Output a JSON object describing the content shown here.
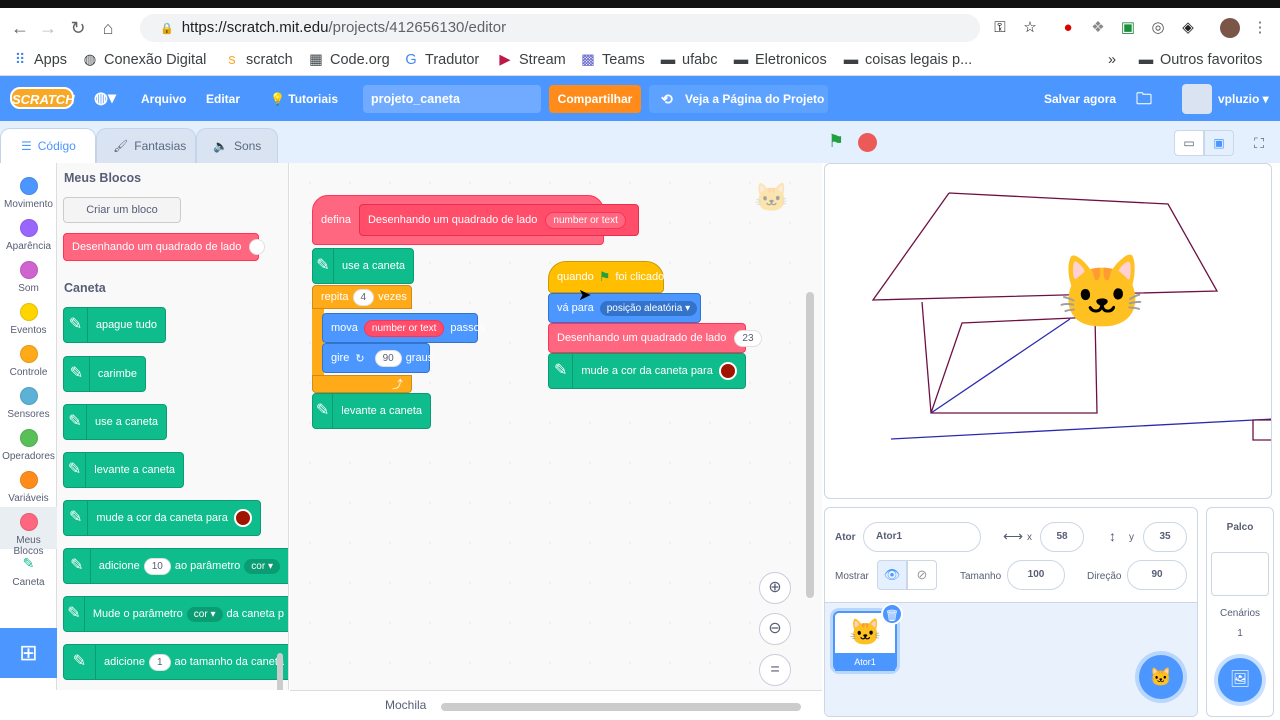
{
  "browser": {
    "url_host": "https://scratch.mit.edu",
    "url_path": "/projects/412656130/editor",
    "bookmarks": [
      "Apps",
      "Conexão Digital",
      "scratch",
      "Code.org",
      "Tradutor",
      "Stream",
      "Teams",
      "ufabc",
      "Eletronicos",
      "coisas legais p...",
      "Outros favoritos"
    ],
    "more": "»"
  },
  "menubar": {
    "logo": "SCRATCH",
    "file": "Arquivo",
    "edit": "Editar",
    "tutorials": "Tutoriais",
    "project_title": "projeto_caneta",
    "share": "Compartilhar",
    "project_page": "Veja a Página do Projeto",
    "save": "Salvar agora",
    "user": "vpluzio"
  },
  "tabs": {
    "code": "Código",
    "costumes": "Fantasias",
    "sounds": "Sons"
  },
  "categories": [
    {
      "label": "Movimento",
      "color": "#4c97ff"
    },
    {
      "label": "Aparência",
      "color": "#9966ff"
    },
    {
      "label": "Som",
      "color": "#cf63cf"
    },
    {
      "label": "Eventos",
      "color": "#ffd500"
    },
    {
      "label": "Controle",
      "color": "#ffab19"
    },
    {
      "label": "Sensores",
      "color": "#5cb1d6"
    },
    {
      "label": "Operadores",
      "color": "#59c059"
    },
    {
      "label": "Variáveis",
      "color": "#ff8c1a"
    },
    {
      "label": "Meus Blocos",
      "color": "#ff6680"
    },
    {
      "label": "Caneta",
      "color": "#0fbd8c"
    }
  ],
  "flyout": {
    "my_blocks_title": "Meus Blocos",
    "make_block": "Criar um bloco",
    "custom_block": "Desenhando um quadrado de lado",
    "pen_title": "Caneta",
    "pen_blocks": [
      "apague tudo",
      "carimbe",
      "use a caneta",
      "levante a caneta",
      "mude a cor da caneta para"
    ],
    "add_param": {
      "prefix": "adicione",
      "value": "10",
      "middle": "ao parâmetro",
      "param": "cor"
    },
    "change_param": {
      "prefix": "Mude o parâmetro",
      "param": "cor",
      "suffix": "da caneta p"
    },
    "add_size": {
      "prefix": "adicione",
      "value": "1",
      "suffix": "ao tamanho da caneta"
    }
  },
  "script1": {
    "define": "defina",
    "define_name": "Desenhando um quadrado de lado",
    "define_param": "number or text",
    "pen_down": "use a caneta",
    "repeat": "repita",
    "repeat_count": "4",
    "repeat_suffix": "vezes",
    "move": "mova",
    "move_param": "number or text",
    "move_suffix": "passos",
    "turn": "gire",
    "turn_value": "90",
    "turn_suffix": "graus",
    "pen_up": "levante a caneta"
  },
  "script2": {
    "when": "quando",
    "clicked": "foi clicado",
    "goto": "vá para",
    "goto_target": "posição aleatória",
    "call": "Desenhando um quadrado de lado",
    "call_value": "23",
    "set_color": "mude a cor da caneta para"
  },
  "workspace": {
    "backpack": "Mochila"
  },
  "sprite_info": {
    "sprite_label": "Ator",
    "sprite_name": "Ator1",
    "x_label": "x",
    "x": "58",
    "y_label": "y",
    "y": "35",
    "show_label": "Mostrar",
    "size_label": "Tamanho",
    "size": "100",
    "direction_label": "Direção",
    "direction": "90"
  },
  "sprite_thumb": "Ator1",
  "stage_panel": {
    "title": "Palco",
    "backdrops_label": "Cenários",
    "backdrops_count": "1"
  },
  "colors": {
    "accent": "#4c97ff",
    "pen": "#0fbd8c",
    "myblocks": "#ff6680",
    "pen_color": "#a01400"
  }
}
